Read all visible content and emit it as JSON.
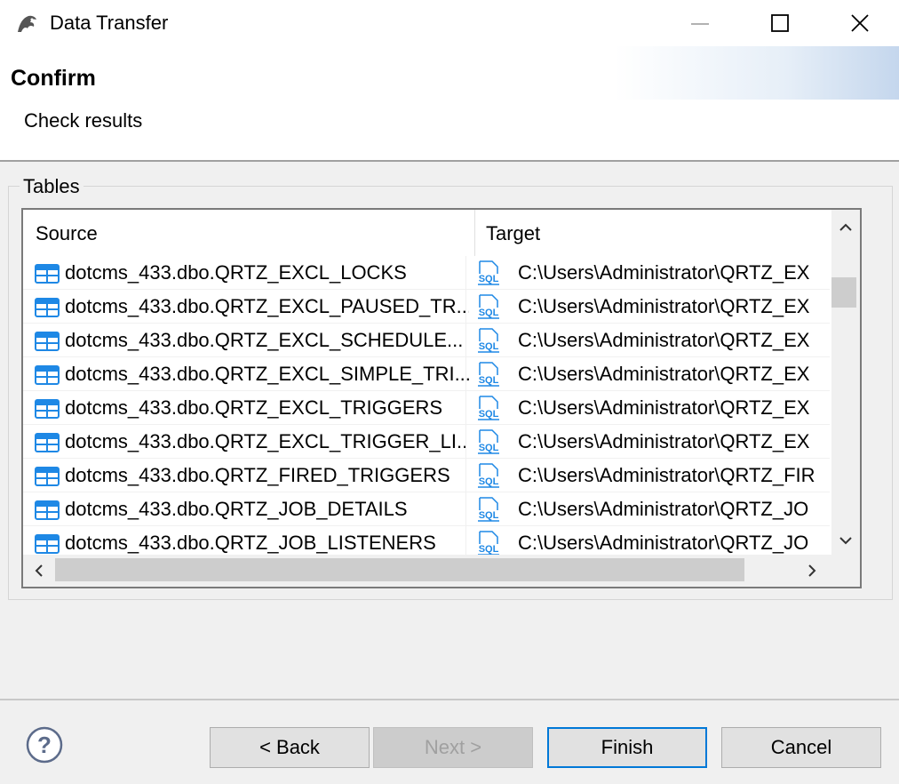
{
  "window": {
    "title": "Data Transfer"
  },
  "header": {
    "title": "Confirm",
    "subtitle": "Check results"
  },
  "group": {
    "label": "Tables"
  },
  "table": {
    "columns": [
      "Source",
      "Target"
    ],
    "rows": [
      {
        "source": "dotcms_433.dbo.QRTZ_EXCL_LOCKS",
        "target": "C:\\Users\\Administrator\\QRTZ_EX"
      },
      {
        "source": "dotcms_433.dbo.QRTZ_EXCL_PAUSED_TR...",
        "target": "C:\\Users\\Administrator\\QRTZ_EX"
      },
      {
        "source": "dotcms_433.dbo.QRTZ_EXCL_SCHEDULE...",
        "target": "C:\\Users\\Administrator\\QRTZ_EX"
      },
      {
        "source": "dotcms_433.dbo.QRTZ_EXCL_SIMPLE_TRI...",
        "target": "C:\\Users\\Administrator\\QRTZ_EX"
      },
      {
        "source": "dotcms_433.dbo.QRTZ_EXCL_TRIGGERS",
        "target": "C:\\Users\\Administrator\\QRTZ_EX"
      },
      {
        "source": "dotcms_433.dbo.QRTZ_EXCL_TRIGGER_LI...",
        "target": "C:\\Users\\Administrator\\QRTZ_EX"
      },
      {
        "source": "dotcms_433.dbo.QRTZ_FIRED_TRIGGERS",
        "target": "C:\\Users\\Administrator\\QRTZ_FIR"
      },
      {
        "source": "dotcms_433.dbo.QRTZ_JOB_DETAILS",
        "target": "C:\\Users\\Administrator\\QRTZ_JO"
      },
      {
        "source": "dotcms_433.dbo.QRTZ_JOB_LISTENERS",
        "target": "C:\\Users\\Administrator\\QRTZ_JO"
      }
    ],
    "source_icon": "table-icon",
    "target_icon": "sql-file-icon",
    "target_icon_label": "SQL"
  },
  "buttons": {
    "back": "< Back",
    "next": "Next >",
    "finish": "Finish",
    "cancel": "Cancel"
  },
  "colors": {
    "accent": "#0078d7",
    "table_icon": "#1e88e5"
  }
}
